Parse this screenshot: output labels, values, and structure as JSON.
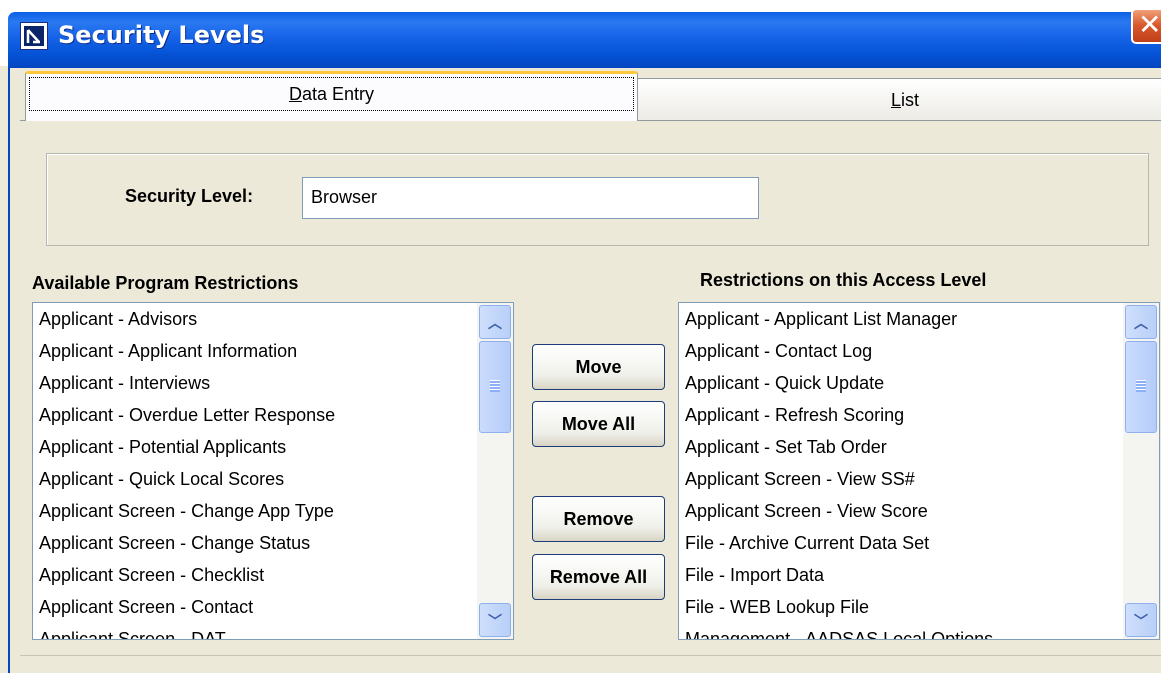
{
  "window": {
    "title": "Security Levels",
    "close_label": "✕"
  },
  "tabs": [
    {
      "label": "Data Entry",
      "accel": "D",
      "rest": "ata Entry",
      "active": true
    },
    {
      "label": "List",
      "accel": "L",
      "rest": "ist",
      "active": false
    }
  ],
  "security_level": {
    "label": "Security Level:",
    "value": "Browser"
  },
  "available": {
    "heading": "Available Program Restrictions",
    "items": [
      "Applicant - Advisors",
      "Applicant - Applicant Information",
      "Applicant - Interviews",
      "Applicant - Overdue Letter Response",
      "Applicant - Potential Applicants",
      "Applicant - Quick Local Scores",
      "Applicant Screen - Change App Type",
      "Applicant Screen - Change Status",
      "Applicant Screen - Checklist",
      "Applicant Screen - Contact",
      "Applicant Screen - DAT"
    ]
  },
  "assigned": {
    "heading": "Restrictions on this Access Level",
    "items": [
      "Applicant - Applicant List Manager",
      "Applicant - Contact Log",
      "Applicant - Quick Update",
      "Applicant - Refresh Scoring",
      "Applicant - Set Tab Order",
      "Applicant Screen - View SS#",
      "Applicant Screen - View Score",
      "File - Archive Current Data Set",
      "File - Import Data",
      "File - WEB Lookup File",
      "Management - AADSAS Local Options"
    ]
  },
  "buttons": {
    "move": "Move",
    "move_all": "Move All",
    "remove": "Remove",
    "remove_all": "Remove All"
  },
  "icons": {
    "scroll_up": "chevron-up-icon",
    "scroll_down": "chevron-down-icon",
    "app": "app-logo-icon"
  }
}
